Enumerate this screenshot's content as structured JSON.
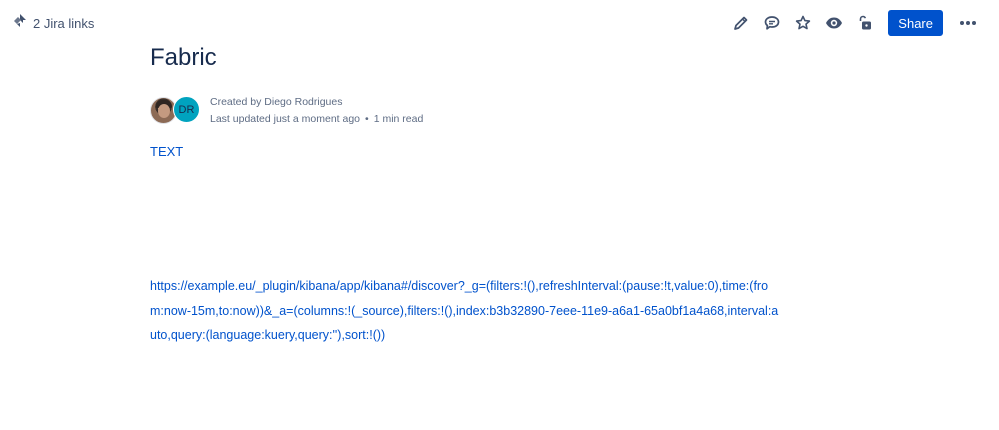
{
  "header": {
    "jira_links_label": "2 Jira links",
    "share_label": "Share"
  },
  "icons": {
    "jira": "jira-icon",
    "edit": "pencil-icon",
    "comment": "comment-icon",
    "star": "star-icon",
    "watch": "eye-icon",
    "restrictions": "unlock-icon",
    "more": "more-icon"
  },
  "page": {
    "title": "Fabric",
    "avatar_initials": "DR",
    "created_by": "Created by Diego Rodrigues",
    "last_updated": "Last updated just a moment ago",
    "separator": "•",
    "read_time": "1 min read"
  },
  "body": {
    "text_link": "TEXT",
    "url": "https://example.eu/_plugin/kibana/app/kibana#/discover?_g=(filters:!(),refreshInterval:(pause:!t,value:0),time:(from:now-15m,to:now))&_a=(columns:!(_source),filters:!(),index:b3b32890-7eee-11e9-a6a1-65a0bf1a4a68,interval:auto,query:(language:kuery,query:''),sort:!())"
  },
  "colors": {
    "primary": "#0052CC",
    "text": "#172B4D",
    "subtle": "#5E6C84",
    "avatar_bg": "#00A3BF"
  }
}
